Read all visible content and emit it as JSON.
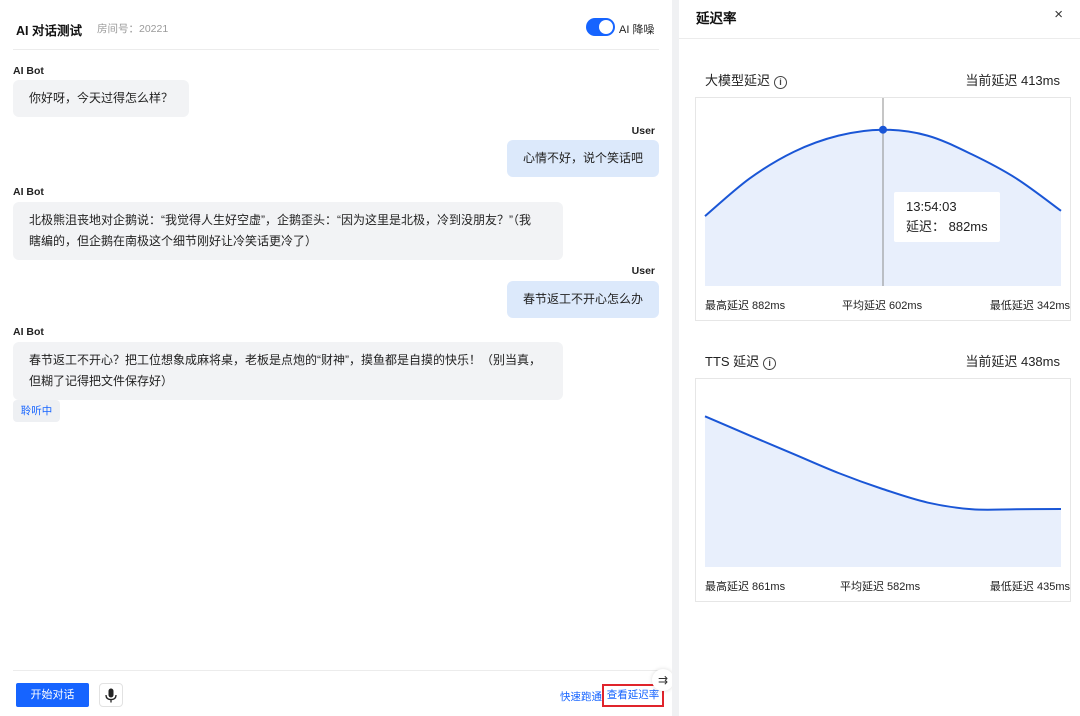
{
  "chat": {
    "title": "AI 对话测试",
    "room": "房间号：20221",
    "noise_toggle_label": "AI 降噪",
    "messages": [
      {
        "role": "bot",
        "sender": "AI Bot",
        "text": "你好呀，今天过得怎么样？"
      },
      {
        "role": "user",
        "sender": "User",
        "text": "心情不好，说个笑话吧"
      },
      {
        "role": "bot",
        "sender": "AI Bot",
        "text_lines": [
          "北极熊沮丧地对企鹅说：“我觉得人生好空虚”，企鹅歪头：“因为这里是北极，冷到没朋友？”（我",
          "瞎编的，但企鹅在南极这个细节刚好让冷笑话更冷了）"
        ]
      },
      {
        "role": "user",
        "sender": "User",
        "text": "春节返工不开心怎么办"
      },
      {
        "role": "bot",
        "sender": "AI Bot",
        "text_lines": [
          "春节返工不开心？把工位想象成麻将桌，老板是点炮的“财神”，摸鱼都是自摸的快乐！（别当真，",
          "但糊了记得把文件保存好）"
        ]
      }
    ],
    "status_badge": "聆听中",
    "start_button": "开始对话",
    "quick_link": "快速跑通",
    "latency_link": "查看延迟率",
    "collapse_icon": "collapse-icon"
  },
  "panel": {
    "title": "延迟率",
    "close": "×",
    "sections": [
      {
        "title": "大模型延迟",
        "current": "当前延迟 413ms",
        "max_label": "最高延迟  882ms",
        "avg_label": "平均延迟 602ms",
        "min_label": "最低延迟 342ms",
        "tooltip_time": "13:54:03",
        "tooltip_value": "延迟：  882ms"
      },
      {
        "title": "TTS 延迟",
        "current": "当前延迟 438ms",
        "max_label": "最高延迟 861ms",
        "avg_label": "平均延迟 582ms",
        "min_label": "最低延迟 435ms"
      }
    ]
  },
  "colors": {
    "accent": "#1664ff",
    "line": "#1a56d6",
    "area": "#e8effc",
    "highlight_border": "#e0242b"
  },
  "chart_data": [
    {
      "type": "area",
      "title": "大模型延迟",
      "ylabel": "",
      "unit": "ms",
      "x": [
        0,
        1,
        2,
        3,
        4,
        5,
        6,
        7,
        8
      ],
      "values": [
        560,
        700,
        800,
        860,
        882,
        860,
        790,
        700,
        580
      ],
      "ylim": [
        300,
        1000
      ],
      "highlight": {
        "time": "13:54:03",
        "value": 882
      },
      "max": 882,
      "avg": 602,
      "min": 342,
      "current": 413
    },
    {
      "type": "area",
      "title": "TTS 延迟",
      "ylabel": "",
      "unit": "ms",
      "x": [
        0,
        1,
        2,
        3,
        4,
        5,
        6,
        7,
        8
      ],
      "values": [
        861,
        790,
        720,
        650,
        590,
        540,
        515,
        515,
        516
      ],
      "ylim": [
        300,
        1000
      ],
      "max": 861,
      "avg": 582,
      "min": 435,
      "current": 438
    }
  ]
}
